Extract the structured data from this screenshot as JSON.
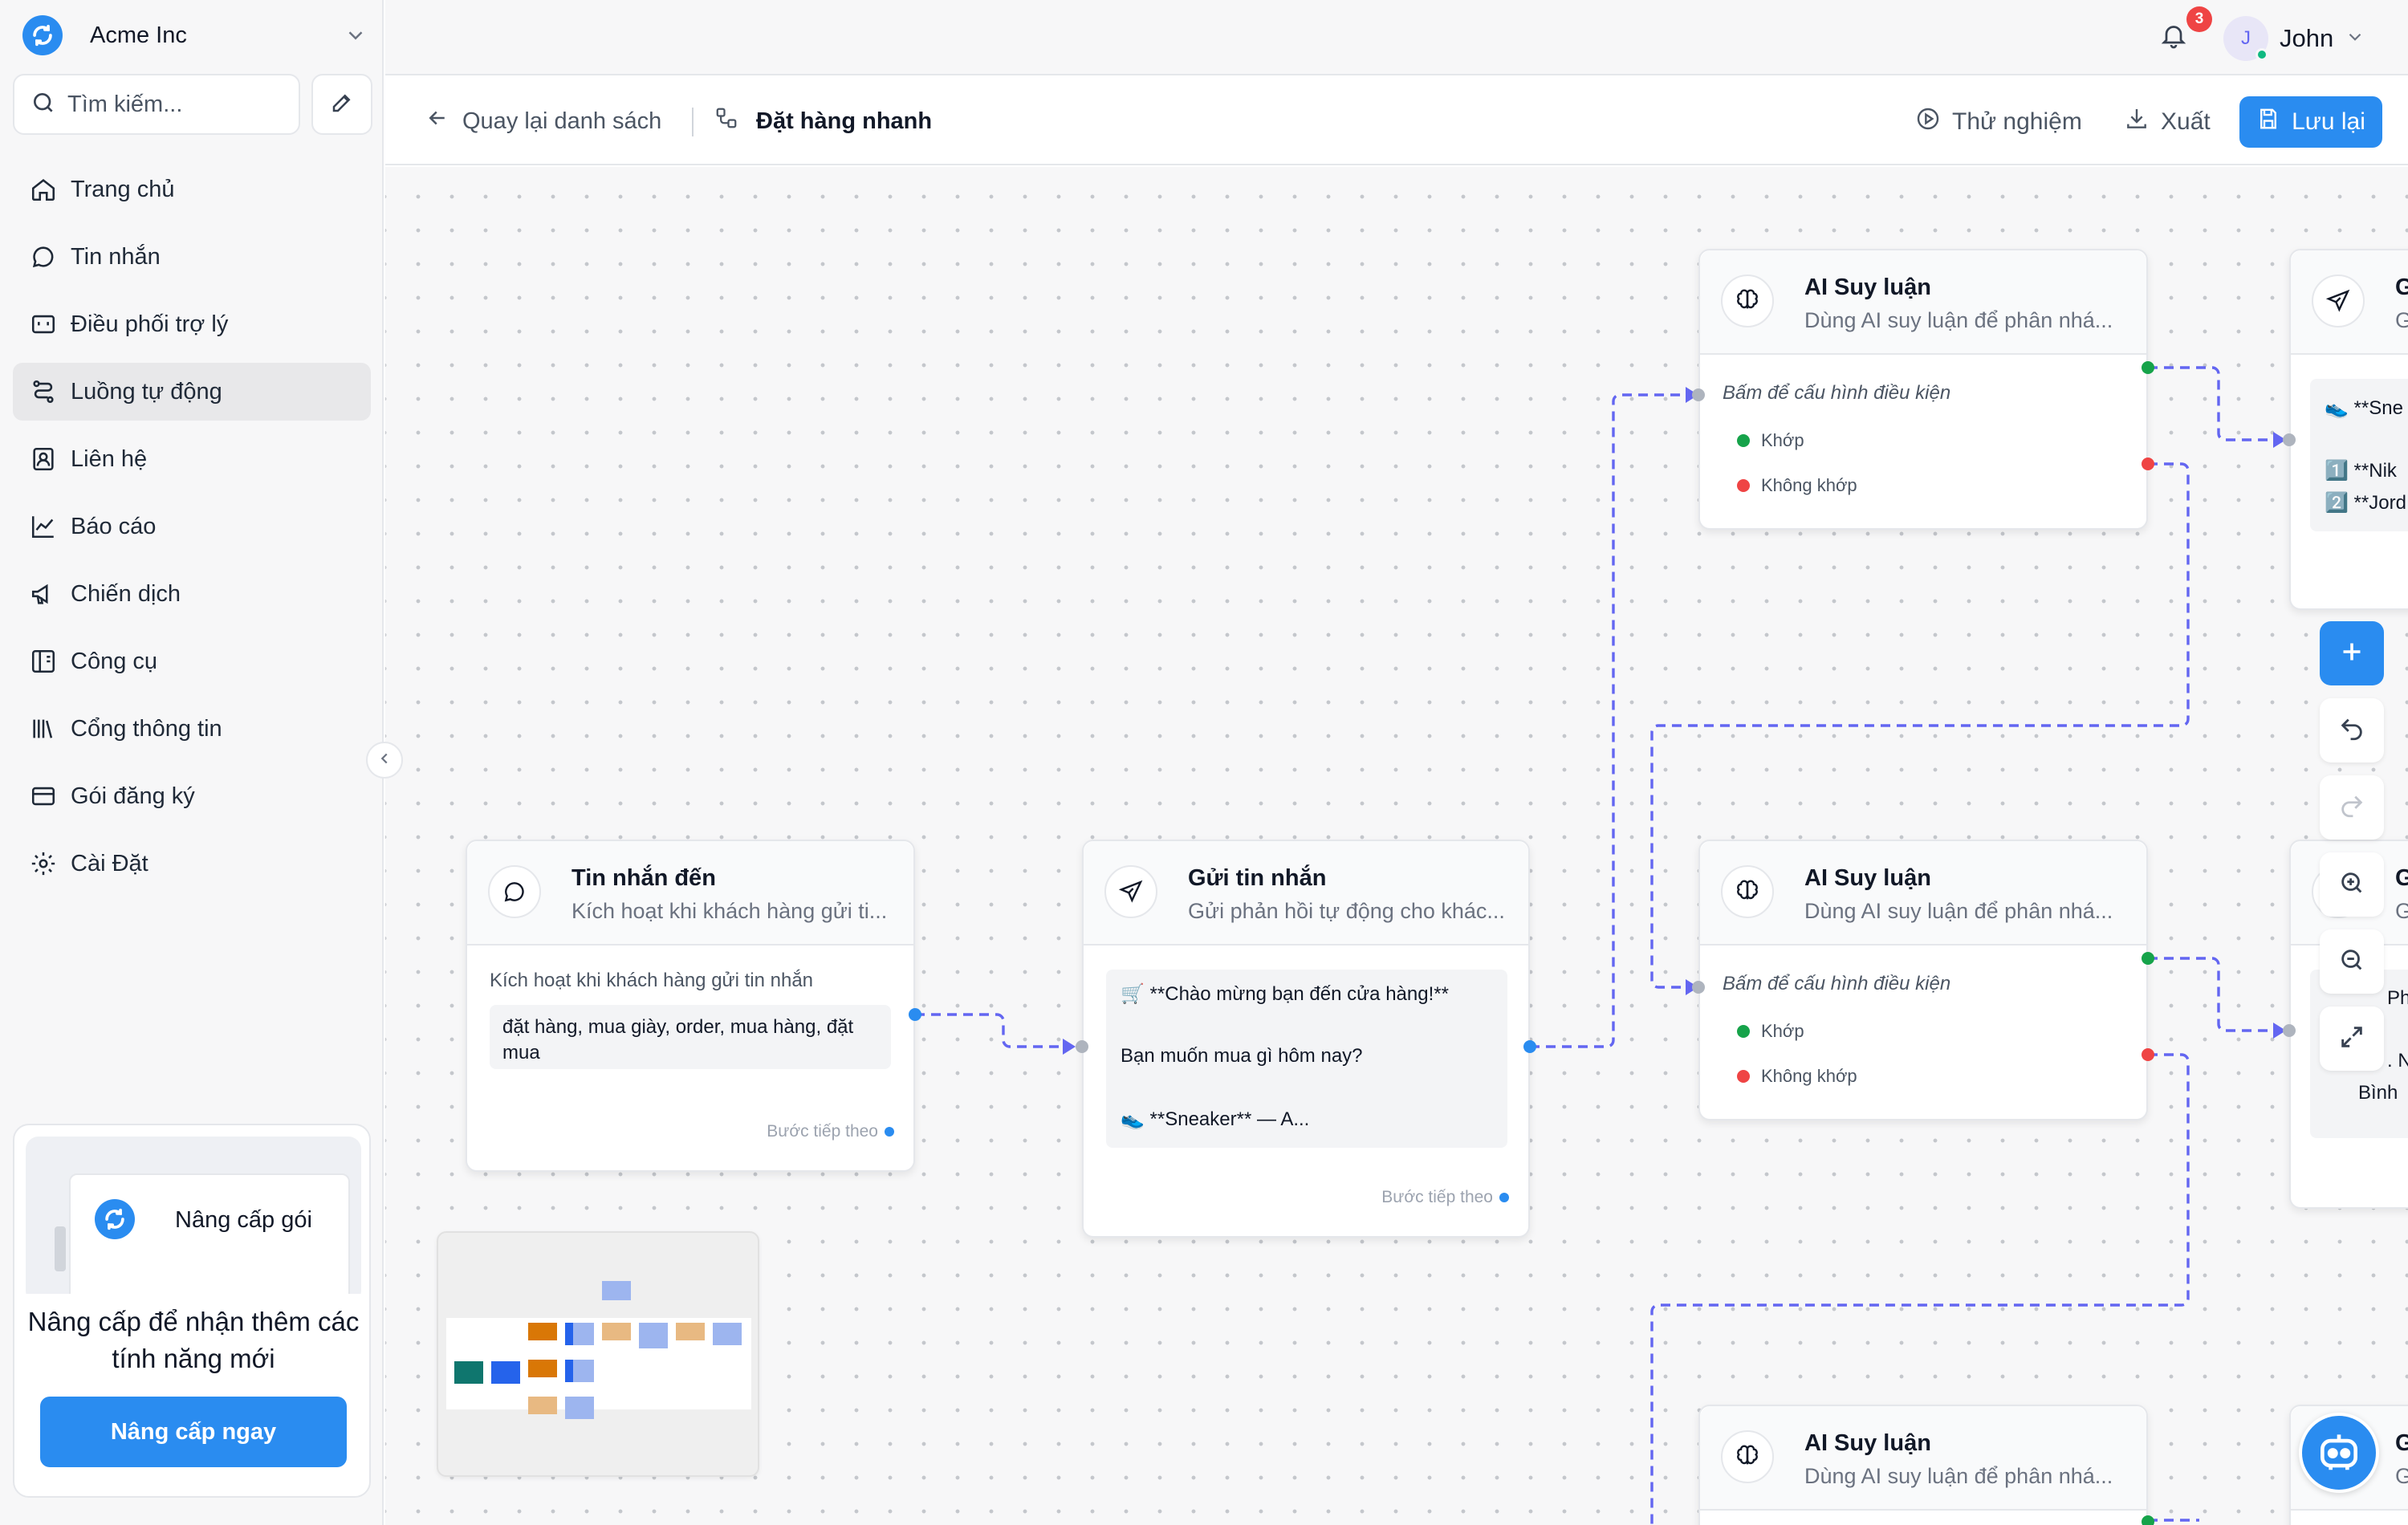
{
  "org": {
    "name": "Acme Inc"
  },
  "search": {
    "placeholder": "Tìm kiếm..."
  },
  "sidebar": {
    "items": [
      {
        "label": "Trang chủ",
        "icon": "home-icon"
      },
      {
        "label": "Tin nhắn",
        "icon": "message-icon"
      },
      {
        "label": "Điều phối trợ lý",
        "icon": "bot-icon"
      },
      {
        "label": "Luồng tự động",
        "icon": "workflow-icon",
        "active": true
      },
      {
        "label": "Liên hệ",
        "icon": "contact-icon"
      },
      {
        "label": "Báo cáo",
        "icon": "chart-icon"
      },
      {
        "label": "Chiến dịch",
        "icon": "megaphone-icon"
      },
      {
        "label": "Công cụ",
        "icon": "tools-icon"
      },
      {
        "label": "Cổng thông tin",
        "icon": "library-icon"
      },
      {
        "label": "Gói đăng ký",
        "icon": "card-icon"
      },
      {
        "label": "Cài Đặt",
        "icon": "gear-icon"
      }
    ]
  },
  "upgrade": {
    "card_title": "Nâng cấp gói",
    "message": "Nâng cấp để nhận thêm các tính năng mới",
    "button": "Nâng cấp ngay"
  },
  "header": {
    "notification_count": "3",
    "user_name": "John",
    "user_initial": "J"
  },
  "toolbar": {
    "back_label": "Quay lại danh sách",
    "flow_title": "Đặt hàng nhanh",
    "test_label": "Thử nghiệm",
    "export_label": "Xuất",
    "save_label": "Lưu lại"
  },
  "nodes": {
    "trigger": {
      "title": "Tin nhắn đến",
      "subtitle": "Kích hoạt khi khách hàng gửi ti...",
      "description": "Kích hoạt khi khách hàng gửi tin nhắn",
      "keywords": "đặt hàng, mua giày, order, mua hàng, đặt mua",
      "next_label": "Bước tiếp theo"
    },
    "send": {
      "title": "Gửi tin nhắn",
      "subtitle": "Gửi phản hồi tự động cho khác...",
      "lines": [
        "🛒 **Chào mừng bạn đến cửa hàng!**",
        "Bạn muốn mua gì hôm nay?",
        "👟 **Sneaker** — A..."
      ],
      "next_label": "Bước tiếp theo"
    },
    "ai1": {
      "title": "AI Suy luận",
      "subtitle": "Dùng AI suy luận để phân nhá...",
      "hint": "Bấm để cấu hình điều kiện",
      "match": "Khớp",
      "nomatch": "Không khớp"
    },
    "ai2": {
      "title": "AI Suy luận",
      "subtitle": "Dùng AI suy luận để phân nhá...",
      "hint": "Bấm để cấu hình điều kiện",
      "match": "Khớp",
      "nomatch": "Không khớp"
    },
    "ai3": {
      "title": "AI Suy luận",
      "subtitle": "Dùng AI suy luận để phân nhá..."
    },
    "peek1": {
      "title": "G",
      "subtitle": "G",
      "lines": [
        "👟 **Sne",
        "1️⃣ **Nik",
        "2️⃣ **Jord"
      ]
    },
    "peek2": {
      "title": "G",
      "subtitle": "G",
      "lines": [
        "Phụ",
        ". Ni",
        "Bình"
      ]
    },
    "peek3": {
      "title": "G",
      "subtitle": "G"
    }
  },
  "colors": {
    "accent": "#2a8cf0",
    "edge": "#6366f1",
    "match": "#16a34a",
    "nomatch": "#ef4444"
  }
}
